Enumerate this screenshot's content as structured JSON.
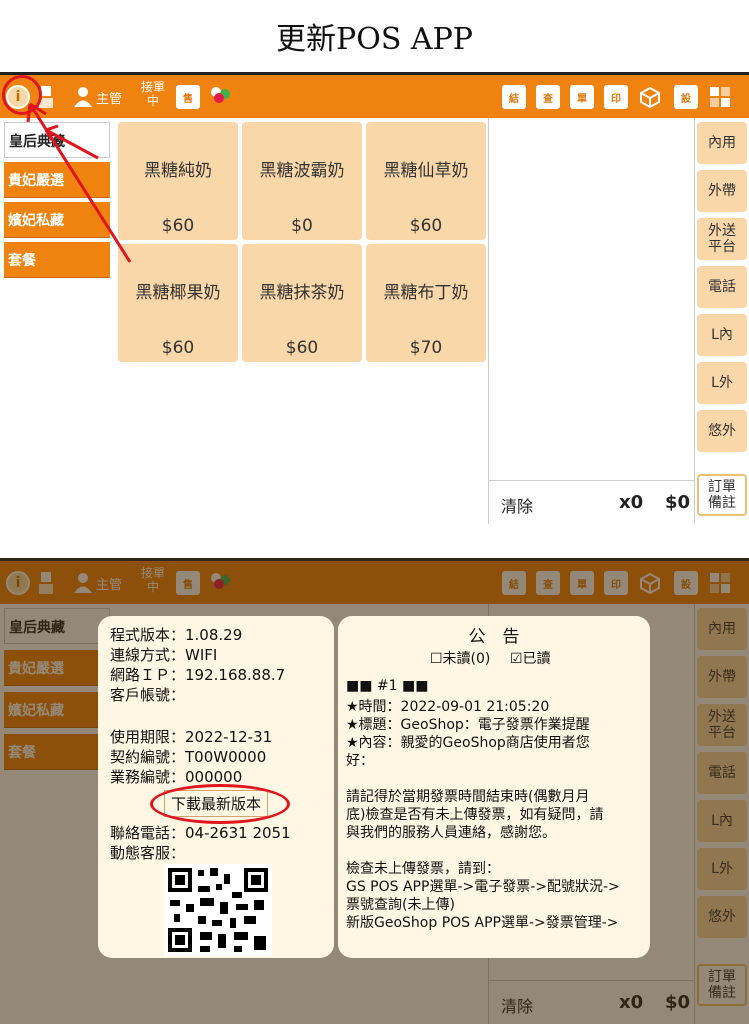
{
  "doc_title": "更新POS APP",
  "topbar": {
    "role_label": "主管",
    "order_status": "接單中",
    "icons": [
      "info-icon",
      "network-icon",
      "user-icon",
      "order-status-icon",
      "sale-icon",
      "staff-icon",
      "function-icon-1",
      "function-icon-2",
      "function-icon-3",
      "function-icon-4",
      "cube-icon",
      "function-icon-5",
      "layout-icon"
    ]
  },
  "categories": [
    {
      "label": "皇后典藏"
    },
    {
      "label": "貴妃嚴選"
    },
    {
      "label": "嬪妃私藏"
    },
    {
      "label": "套餐"
    }
  ],
  "menu_items": [
    {
      "name": "黑糖純奶",
      "price": "$60"
    },
    {
      "name": "黑糖波霸奶",
      "price": "$0"
    },
    {
      "name": "黑糖仙草奶",
      "price": "$60"
    },
    {
      "name": "黑糖椰果奶",
      "price": "$60"
    },
    {
      "name": "黑糖抹茶奶",
      "price": "$60"
    },
    {
      "name": "黑糖布丁奶",
      "price": "$70"
    }
  ],
  "order_types": [
    {
      "label": "內用"
    },
    {
      "label": "外帶"
    },
    {
      "label": "外送\n平台"
    },
    {
      "label": "電話"
    },
    {
      "label": "L內"
    },
    {
      "label": "L外"
    },
    {
      "label": "悠外"
    }
  ],
  "order_note_label": "訂單\n備註",
  "order_summary": {
    "clear_label": "清除",
    "qty": "x0",
    "amount": "$0"
  },
  "info_dialog": {
    "version": "程式版本：1.08.29",
    "connection": "連線方式：WIFI",
    "ip": "網路ＩＰ：192.168.88.7",
    "account": "客戶帳號：",
    "expiry": "使用期限：2022-12-31",
    "contract": "契約編號：T00W0000",
    "sales": "業務編號：000000",
    "download_label": "下載最新版本",
    "phone": "聯絡電話：04-2631 2051",
    "support": "動態客服："
  },
  "notice_dialog": {
    "title": "公　告",
    "unread_label": "☐未讀(0)",
    "read_label": "☑已讀",
    "lines": [
      "■■ #1 ■■",
      "★時間：2022-09-01 21:05:20",
      "★標題：GeoShop：電子發票作業提醒",
      "★內容：親愛的GeoShop商店使用者您",
      "好：",
      "",
      "請記得於當期發票時間結束時(偶數月月",
      "底)檢查是否有未上傳發票，如有疑問，請",
      "與我們的服務人員連絡，感謝您。",
      "",
      "檢查未上傳發票，請到：",
      "GS POS APP選單->電子發票->配號狀況->",
      "票號查詢(未上傳)",
      "新版GeoShop POS APP選單->發票管理->"
    ]
  },
  "colors": {
    "topbar": "#f0820f",
    "item": "#f9d7a8",
    "annotation": "#e0161f"
  }
}
